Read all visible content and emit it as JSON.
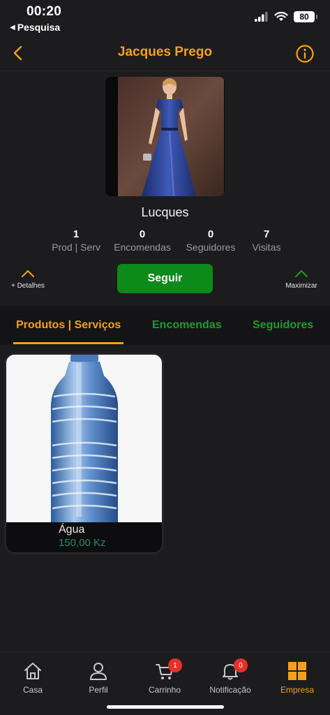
{
  "status_bar": {
    "time": "00:20",
    "back_app": "Pesquisa",
    "battery": "80"
  },
  "header": {
    "title": "Jacques Prego",
    "accent_color": "#f4a11a"
  },
  "profile": {
    "name": "Lucques",
    "stats": [
      {
        "value": "1",
        "label": "Prod | Serv"
      },
      {
        "value": "0",
        "label": "Encomendas"
      },
      {
        "value": "0",
        "label": "Seguidores"
      },
      {
        "value": "7",
        "label": "Visitas"
      }
    ],
    "details_label": "+ Detalhes",
    "maximize_label": "Maximizar",
    "follow_label": "Seguir"
  },
  "tabs": [
    {
      "label": "Produtos | Serviços",
      "active": true
    },
    {
      "label": "Encomendas",
      "active": false
    },
    {
      "label": "Seguidores",
      "active": false
    }
  ],
  "products": [
    {
      "name": "Água",
      "price": "150,00 Kz"
    }
  ],
  "bottom_nav": [
    {
      "label": "Casa",
      "icon": "home-icon"
    },
    {
      "label": "Perfil",
      "icon": "person-icon"
    },
    {
      "label": "Carrinho",
      "icon": "cart-icon",
      "badge": "1"
    },
    {
      "label": "Notificação",
      "icon": "bell-icon",
      "badge": "0"
    },
    {
      "label": "Empresa",
      "icon": "grid-icon",
      "active": true
    }
  ]
}
